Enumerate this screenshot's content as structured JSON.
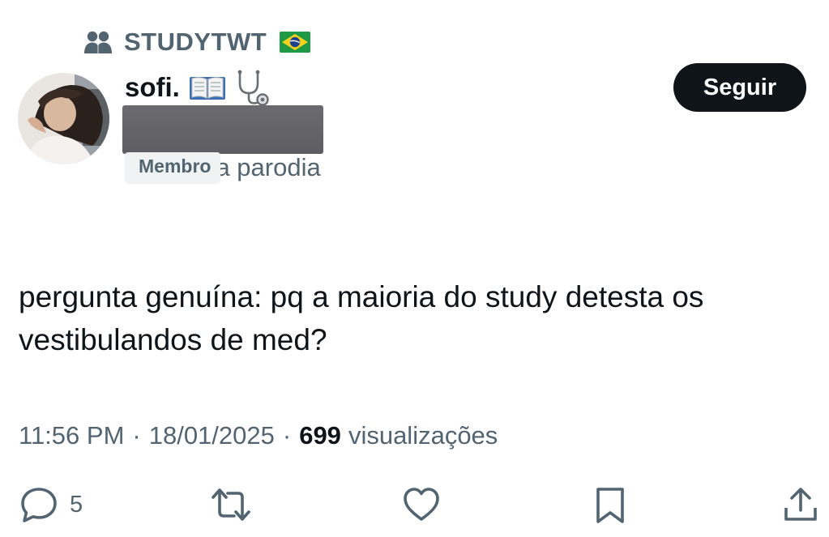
{
  "community": {
    "name": "STUDYTWT",
    "icon": "community-people-icon",
    "flag_icon": "brazil-flag-icon"
  },
  "author": {
    "display_name": "sofi.",
    "name_emojis": [
      "open-book-emoji",
      "stethoscope-emoji"
    ],
    "badge": "Membro",
    "parody_label": "a parodia",
    "avatar": "profile-photo"
  },
  "follow_button": {
    "label": "Seguir"
  },
  "tweet": {
    "text": "pergunta genuína: pq a maioria do study detesta os\nvestibulandos de med?"
  },
  "meta": {
    "time": "11:56 PM",
    "separator": "·",
    "date": "18/01/2025",
    "views_count": "699",
    "views_label": "visualizações"
  },
  "actions": {
    "reply": {
      "icon": "reply-icon",
      "count": "5"
    },
    "retweet": {
      "icon": "retweet-icon"
    },
    "like": {
      "icon": "heart-icon"
    },
    "bookmark": {
      "icon": "bookmark-icon"
    },
    "share": {
      "icon": "share-icon"
    }
  },
  "colors": {
    "text_primary": "#0f1419",
    "text_secondary": "#536471",
    "badge_bg": "#eff3f4",
    "redaction": "#616165"
  }
}
